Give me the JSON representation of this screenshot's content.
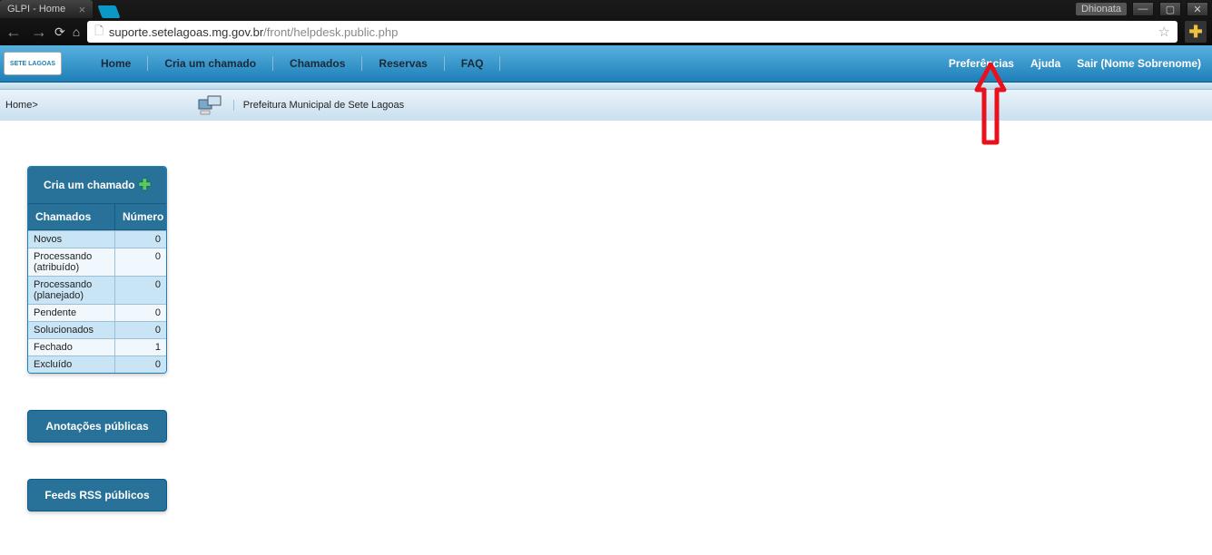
{
  "browser": {
    "tab_title": "GLPI - Home",
    "url_domain": "suporte.setelagoas.mg.gov.br",
    "url_path": "/front/helpdesk.public.php",
    "user": "Dhionata"
  },
  "glpi": {
    "logo_text": "SETE LAGOAS",
    "menu": [
      "Home",
      "Cria um chamado",
      "Chamados",
      "Reservas",
      "FAQ"
    ],
    "right": {
      "prefs": "Preferências",
      "help": "Ajuda",
      "logout_prefix": "Sair",
      "logout_name": "(Nome Sobrenome)"
    }
  },
  "breadcrumb": {
    "home": "Home>",
    "org": "Prefeitura Municipal de Sete Lagoas"
  },
  "tickets": {
    "create_label": "Cria um chamado",
    "col_label": "Chamados",
    "col_num": "Número",
    "rows": [
      {
        "label": "Novos",
        "num": "0"
      },
      {
        "label": "Processando (atribuído)",
        "num": "0"
      },
      {
        "label": "Processando (planejado)",
        "num": "0"
      },
      {
        "label": "Pendente",
        "num": "0"
      },
      {
        "label": "Solucionados",
        "num": "0"
      },
      {
        "label": "Fechado",
        "num": "1"
      },
      {
        "label": "Excluído",
        "num": "0"
      }
    ]
  },
  "buttons": {
    "notes": "Anotações públicas",
    "rss": "Feeds RSS públicos"
  }
}
